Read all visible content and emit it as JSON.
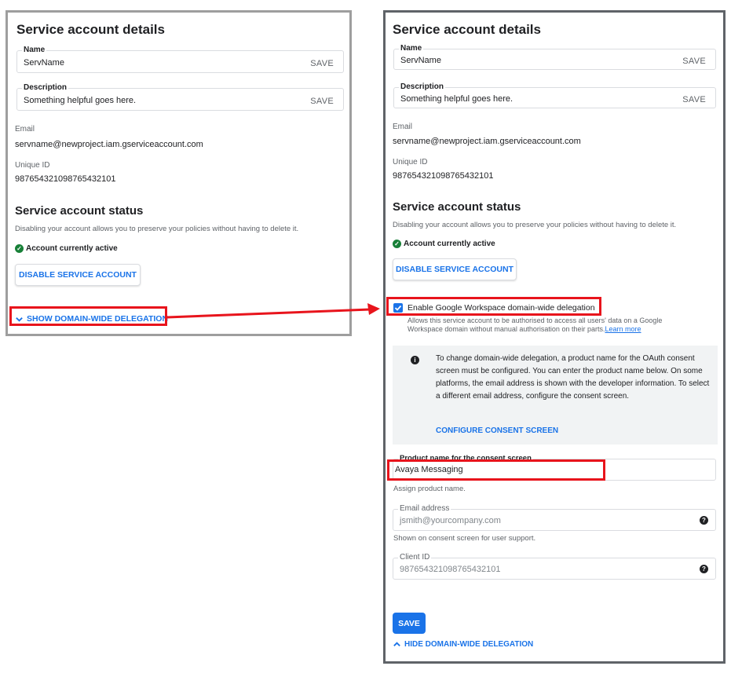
{
  "details": {
    "title": "Service account details",
    "name_label": "Name",
    "name_value": "ServName",
    "description_label": "Description",
    "description_value": "Something helpful goes here.",
    "save_label": "SAVE",
    "email_label": "Email",
    "email_value": "servname@newproject.iam.gserviceaccount.com",
    "unique_id_label": "Unique ID",
    "unique_id_value": "987654321098765432101"
  },
  "status": {
    "title": "Service account status",
    "description": "Disabling your account allows you to preserve your policies without having to delete it.",
    "active_text": "Account currently active",
    "disable_button": "DISABLE SERVICE ACCOUNT"
  },
  "delegation": {
    "show_label": "SHOW DOMAIN-WIDE DELEGATION",
    "hide_label": "HIDE DOMAIN-WIDE DELEGATION",
    "enable_label": "Enable Google Workspace domain-wide delegation",
    "enable_help": "Allows this service account to be authorised to access all users' data on a Google Workspace domain without manual authorisation on their parts.",
    "learn_more": "Learn more",
    "info_text": "To change domain-wide delegation, a product name for the OAuth consent screen must be configured. You can enter the product name below. On some platforms, the email address is shown with the developer information. To select a different email address, configure the consent screen.",
    "configure_link": "CONFIGURE CONSENT SCREEN",
    "product_label": "Product name for the consent screen",
    "product_value": "Avaya Messaging",
    "product_help": "Assign product name.",
    "email_label": "Email address",
    "email_placeholder": "jsmith@yourcompany.com",
    "email_help": "Shown on consent screen for user support.",
    "client_id_label": "Client ID",
    "client_id_value": "987654321098765432101",
    "save_button": "SAVE",
    "enabled": true
  },
  "colors": {
    "accent": "#1a73e8",
    "highlight": "#e8141c",
    "success": "#188038"
  },
  "icons": {
    "chevron_down": "chevron-down-icon",
    "chevron_up": "chevron-up-icon",
    "check_circle": "check-circle-icon",
    "info": "info-icon",
    "help": "help-icon",
    "arrow": "arrow-icon"
  }
}
